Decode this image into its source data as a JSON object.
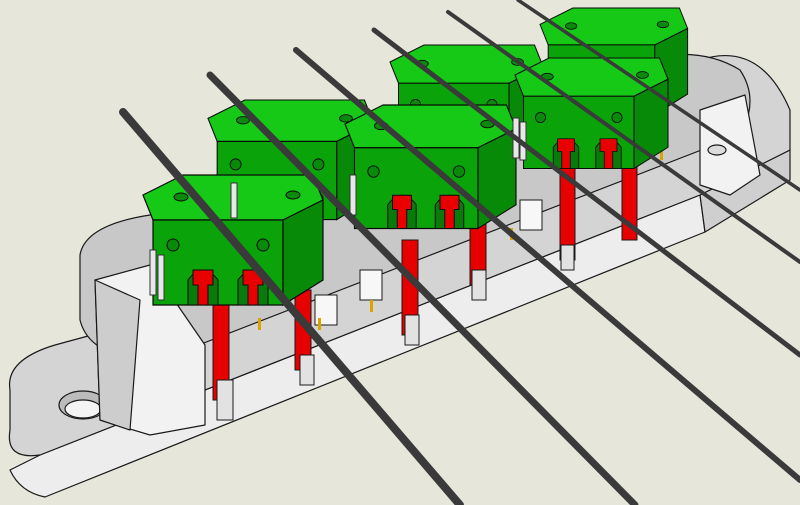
{
  "scene": {
    "description_label": "",
    "colors": {
      "background": "#e6e6db",
      "plate_top": "#d6d6d6",
      "plate_side": "#c4c4c4",
      "plate_front": "#efefef",
      "edge": "#1a1a1a",
      "block_top": "#14c814",
      "block_front": "#0aa00a",
      "block_side": "#078a07",
      "post_red": "#e80000",
      "post_red_dark": "#b00000",
      "post_gray": "#e0e0e0",
      "wire": "#3a3a3a",
      "pin_gold": "#d9a400",
      "switch_white": "#f5f5f5"
    },
    "icons": {
      "block": "terminal-block-icon",
      "post": "contact-post-icon",
      "wire": "string-wire-icon",
      "hole": "mount-hole-icon"
    },
    "counts": {
      "green_blocks": 6,
      "strings": 6
    }
  }
}
